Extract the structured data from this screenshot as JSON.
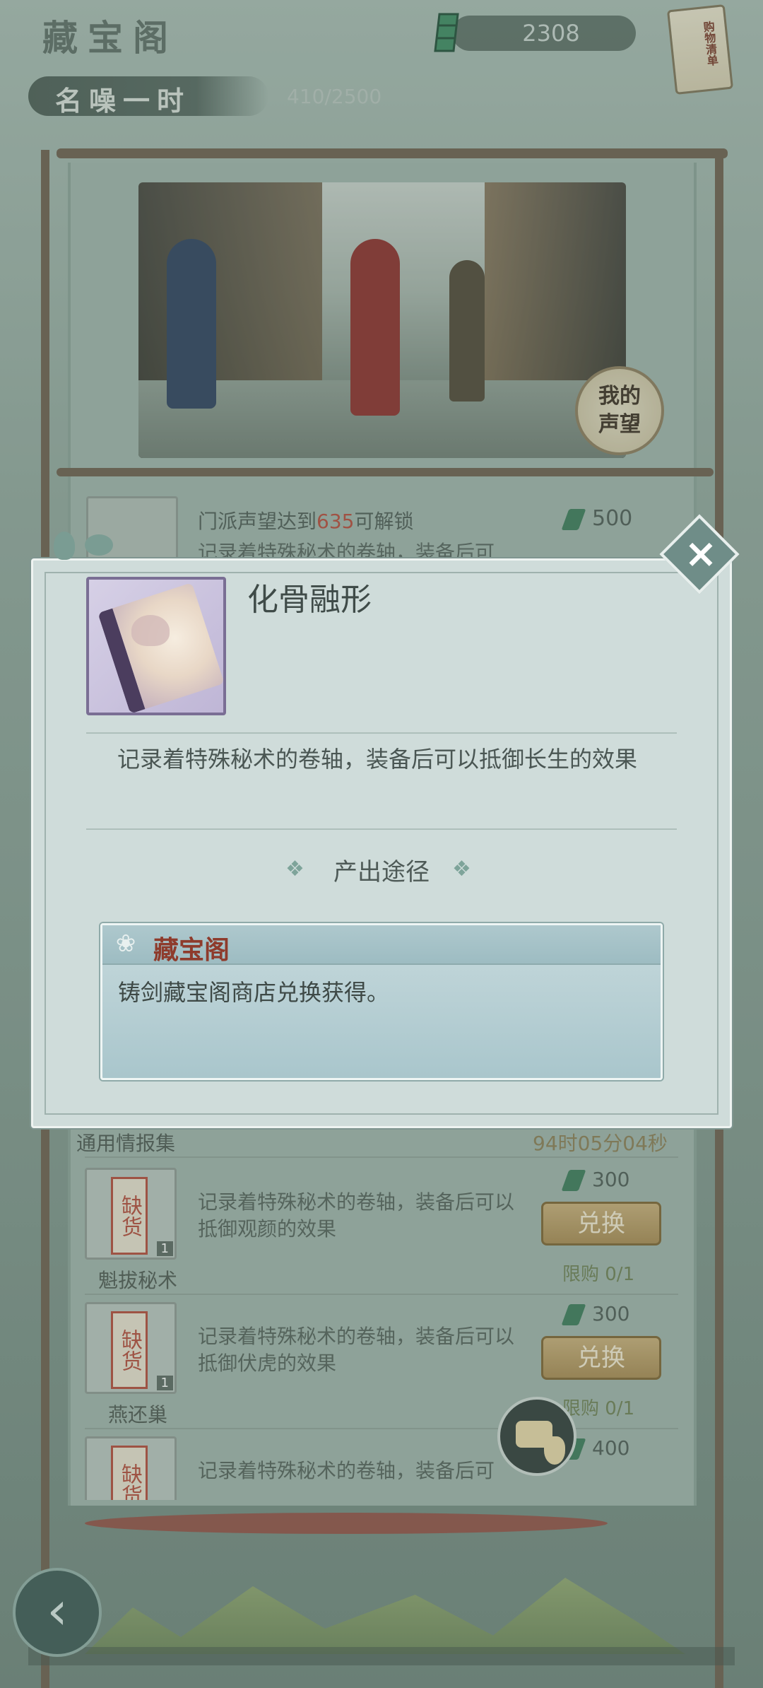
{
  "header": {
    "title": "藏宝阁",
    "currency_value": "2308",
    "shop_list_label": "购物清单"
  },
  "fame": {
    "title": "名噪一时",
    "progress": "410/2500"
  },
  "scene": {
    "seal_text_line1": "我的",
    "seal_text_line2": "声望"
  },
  "locked_item": {
    "unlock_prefix": "门派声望达到",
    "unlock_number": "635",
    "unlock_suffix": "可解锁",
    "description": "记录着特殊秘术的卷轴，装备后可",
    "price": "500"
  },
  "modal": {
    "item_name": "化骨融形",
    "description": "记录着特殊秘术的卷轴，装备后可以抵御长生的效果",
    "source_section_title": "产出途径",
    "source_name": "藏宝阁",
    "source_text": "铸剑藏宝阁商店兑换获得。"
  },
  "list": {
    "section_title": "通用情报集",
    "timer": "94时05分04秒",
    "items": [
      {
        "stock_label": "缺货",
        "qty": "1",
        "name": "魁拔秘术",
        "description": "记录着特殊秘术的卷轴，装备后可以抵御观颜的效果",
        "price": "300",
        "button": "兑换",
        "limit": "限购 0/1"
      },
      {
        "stock_label": "缺货",
        "qty": "1",
        "name": "燕还巢",
        "description": "记录着特殊秘术的卷轴，装备后可以抵御伏虎的效果",
        "price": "300",
        "button": "兑换",
        "limit": "限购 0/1"
      },
      {
        "stock_label": "缺货",
        "description": "记录着特殊秘术的卷轴，装备后可",
        "price": "400"
      }
    ]
  },
  "icons": {
    "close": "close-icon",
    "back": "back-icon",
    "chat": "chat-icon",
    "jade": "jade-currency-icon",
    "lotus": "lotus-icon"
  }
}
